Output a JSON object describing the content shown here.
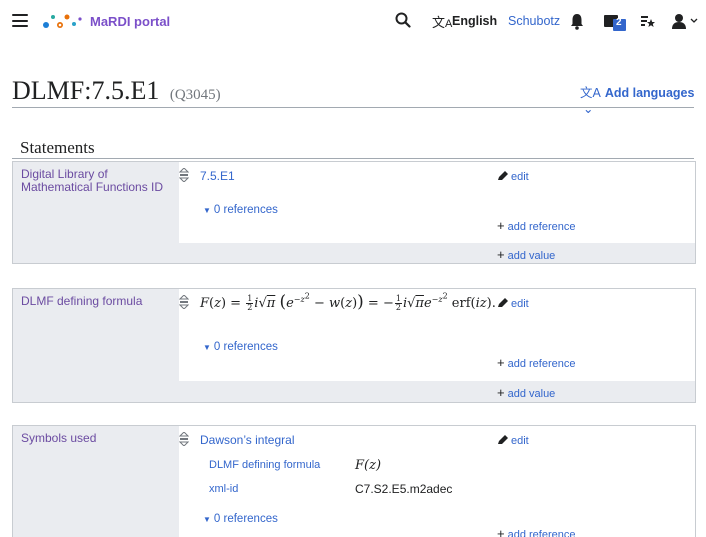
{
  "header": {
    "brand": "MaRDI portal",
    "language": "English",
    "user": "Schubotz",
    "watchlist_count": "2"
  },
  "title": {
    "main": "DLMF:7.5.E1",
    "qid": "(Q3045)",
    "add_languages": "Add languages"
  },
  "statements_heading": "Statements",
  "groups": [
    {
      "property": "Digital Library of Mathematical Functions ID",
      "value": "7.5.E1",
      "edit": "edit",
      "references": "0 references",
      "add_reference": "add reference",
      "add_value": "add value"
    },
    {
      "property": "DLMF defining formula",
      "edit": "edit",
      "references": "0 references",
      "add_reference": "add reference",
      "add_value": "add value"
    },
    {
      "property": "Symbols used",
      "value": "Dawson’s integral",
      "edit": "edit",
      "qualifiers": [
        {
          "name": "DLMF defining formula",
          "value": "F(z)"
        },
        {
          "name": "xml-id",
          "value": "C7.S2.E5.m2adec"
        }
      ],
      "references": "0 references",
      "add_reference": "add reference"
    }
  ],
  "colors": {
    "link": "#3366cc",
    "property": "#6b4ba1",
    "brand": "#7b4fc9",
    "group_bg": "#eaecf0"
  }
}
